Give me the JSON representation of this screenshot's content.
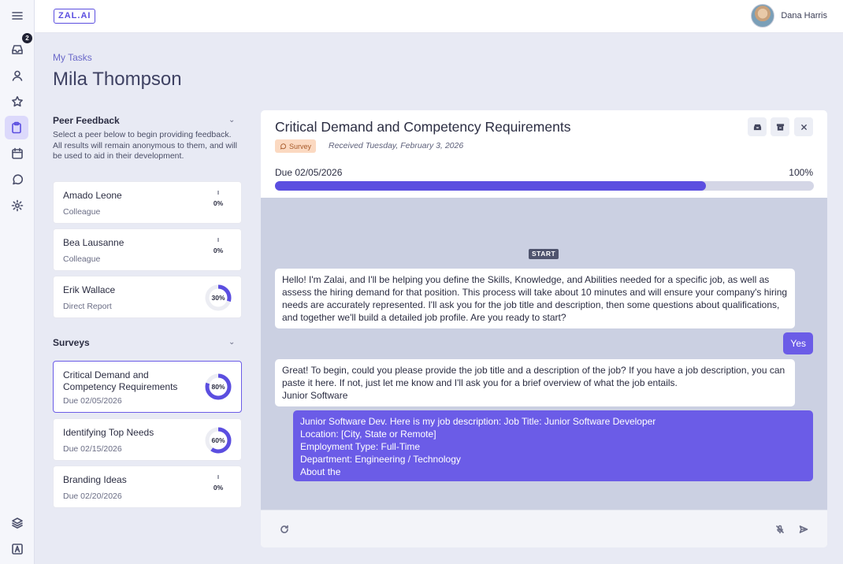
{
  "app": {
    "logo": "ZAL.AI",
    "notification_count": "2"
  },
  "user": {
    "name": "Dana Harris"
  },
  "header": {
    "breadcrumb": "My Tasks",
    "person_name": "Mila Thompson"
  },
  "peer_feedback": {
    "title": "Peer Feedback",
    "description": "Select a peer below to begin providing feedback. All results will remain anonymous to them, and will be used to aid in their development.",
    "items": [
      {
        "name": "Amado Leone",
        "role": "Colleague",
        "percent": "0%",
        "progress": 0
      },
      {
        "name": "Bea Lausanne",
        "role": "Colleague",
        "percent": "0%",
        "progress": 0
      },
      {
        "name": "Erik Wallace",
        "role": "Direct Report",
        "percent": "30%",
        "progress": 0.3
      }
    ]
  },
  "surveys": {
    "title": "Surveys",
    "items": [
      {
        "name": "Critical Demand and Competency Requirements",
        "due": "Due 02/05/2026",
        "percent": "80%",
        "progress": 0.8
      },
      {
        "name": "Identifying Top Needs",
        "due": "Due 02/15/2026",
        "percent": "60%",
        "progress": 0.6
      },
      {
        "name": "Branding Ideas",
        "due": "Due 02/20/2026",
        "percent": "0%",
        "progress": 0
      }
    ]
  },
  "task": {
    "title": "Critical Demand and Competency Requirements",
    "tag": "Survey",
    "received": "Received Tuesday, February 3, 2026",
    "due": "Due 02/05/2026",
    "progress_label": "100%",
    "progress": 0.8
  },
  "chat": {
    "start_label": "START",
    "messages": [
      {
        "from": "bot",
        "text": "Hello! I'm Zalai, and I'll be helping you define the Skills, Knowledge, and Abilities needed for a specific job, as well as assess the hiring demand for that position. This process will take about 10 minutes and will ensure your company's hiring needs are accurately represented. I'll ask you for the job title and description, then some questions about qualifications, and together we'll build a detailed job profile. Are you ready to start?"
      },
      {
        "from": "user",
        "text": "Yes"
      },
      {
        "from": "bot",
        "text": "Great! To begin, could you please provide the job title and a description of the job? If you have a job description, you can paste it here. If not, just let me know and I'll ask you for a brief overview of what the job entails.\nJunior Software"
      },
      {
        "from": "user",
        "text": "Junior Software Dev. Here is my job description: Job Title: Junior Software Developer\nLocation: [City, State or Remote]\nEmployment Type: Full-Time\nDepartment: Engineering / Technology\nAbout the"
      }
    ]
  },
  "colors": {
    "accent": "#5b4ee0",
    "user_bubble": "#6b5ce7",
    "chat_bg": "#cbd0e2",
    "tag_bg": "#fbd9c1"
  }
}
